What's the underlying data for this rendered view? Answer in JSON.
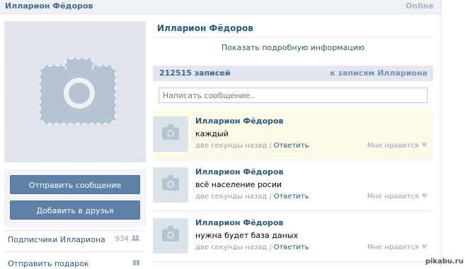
{
  "header": {
    "name": "Илларион Фёдоров",
    "status": "Online"
  },
  "profile": {
    "name": "Илларион Фёдоров",
    "details_link": "Показать подробную информацию"
  },
  "actions": {
    "send_message": "Отправить сообщение",
    "add_friend": "Добавить в друзья"
  },
  "left_links": [
    {
      "label": "Подписчики Иллариона",
      "count": "934",
      "icon": "users-icon"
    },
    {
      "label": "Отправить подарок",
      "icon": "gift-icon"
    }
  ],
  "wall": {
    "count_label": "212515 записей",
    "to_posts_link": "к записям Иллариона",
    "composer_placeholder": "Написать сообщение.."
  },
  "posts": [
    {
      "author": "Илларион Фёдоров",
      "text": "каждый",
      "time": "две секунды назад",
      "reply": "Ответить",
      "like": "Мне нравится"
    },
    {
      "author": "Илларион Фёдоров",
      "text": "всё население росии",
      "time": "две секунды назад",
      "reply": "Ответить",
      "like": "Мне нравится"
    },
    {
      "author": "Илларион Фёдоров",
      "text": "нужна будет база даных",
      "time": "две секунды назад",
      "reply": "Ответить",
      "like": "Мне нравится"
    }
  ],
  "watermark": "pikabu.ru"
}
